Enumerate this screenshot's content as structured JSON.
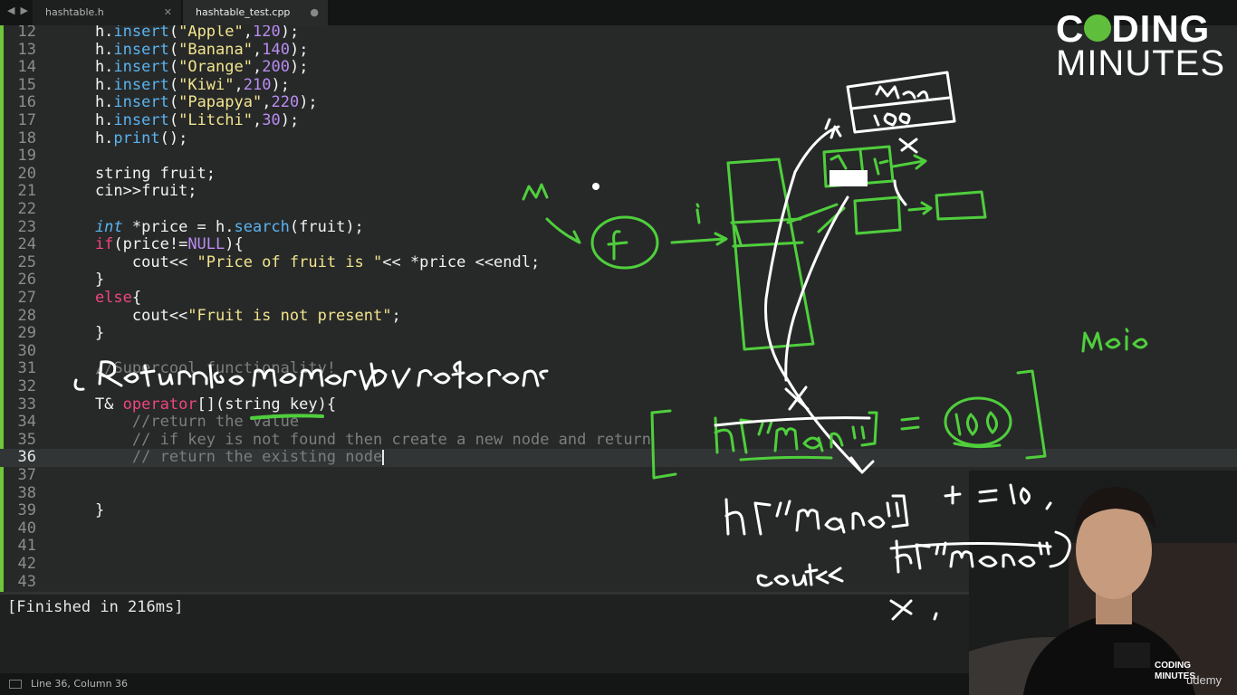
{
  "tabs": [
    {
      "label": "hashtable.h",
      "icon": "close-icon"
    },
    {
      "label": "hashtable_test.cpp",
      "icon": "dirty-dot-icon"
    }
  ],
  "editor": {
    "current_line": 36,
    "lines": [
      {
        "n": "12",
        "tokens": [
          [
            "plain",
            "    h."
          ],
          [
            "method",
            "insert"
          ],
          [
            "plain",
            "("
          ],
          [
            "string",
            "\"Apple\""
          ],
          [
            "plain",
            ","
          ],
          [
            "number",
            "120"
          ],
          [
            "plain",
            ");"
          ]
        ]
      },
      {
        "n": "13",
        "tokens": [
          [
            "plain",
            "    h."
          ],
          [
            "method",
            "insert"
          ],
          [
            "plain",
            "("
          ],
          [
            "string",
            "\"Banana\""
          ],
          [
            "plain",
            ","
          ],
          [
            "number",
            "140"
          ],
          [
            "plain",
            ");"
          ]
        ]
      },
      {
        "n": "14",
        "tokens": [
          [
            "plain",
            "    h."
          ],
          [
            "method",
            "insert"
          ],
          [
            "plain",
            "("
          ],
          [
            "string",
            "\"Orange\""
          ],
          [
            "plain",
            ","
          ],
          [
            "number",
            "200"
          ],
          [
            "plain",
            ");"
          ]
        ]
      },
      {
        "n": "15",
        "tokens": [
          [
            "plain",
            "    h."
          ],
          [
            "method",
            "insert"
          ],
          [
            "plain",
            "("
          ],
          [
            "string",
            "\"Kiwi\""
          ],
          [
            "plain",
            ","
          ],
          [
            "number",
            "210"
          ],
          [
            "plain",
            ");"
          ]
        ]
      },
      {
        "n": "16",
        "tokens": [
          [
            "plain",
            "    h."
          ],
          [
            "method",
            "insert"
          ],
          [
            "plain",
            "("
          ],
          [
            "string",
            "\"Papapya\""
          ],
          [
            "plain",
            ","
          ],
          [
            "number",
            "220"
          ],
          [
            "plain",
            ");"
          ]
        ]
      },
      {
        "n": "17",
        "tokens": [
          [
            "plain",
            "    h."
          ],
          [
            "method",
            "insert"
          ],
          [
            "plain",
            "("
          ],
          [
            "string",
            "\"Litchi\""
          ],
          [
            "plain",
            ","
          ],
          [
            "number",
            "30"
          ],
          [
            "plain",
            ");"
          ]
        ]
      },
      {
        "n": "18",
        "tokens": [
          [
            "plain",
            "    h."
          ],
          [
            "method",
            "print"
          ],
          [
            "plain",
            "();"
          ]
        ]
      },
      {
        "n": "19",
        "tokens": []
      },
      {
        "n": "20",
        "tokens": [
          [
            "plain",
            "    string fruit;"
          ]
        ]
      },
      {
        "n": "21",
        "tokens": [
          [
            "plain",
            "    cin>>fruit;"
          ]
        ]
      },
      {
        "n": "22",
        "tokens": []
      },
      {
        "n": "23",
        "tokens": [
          [
            "type",
            "    int"
          ],
          [
            "plain",
            " *price = h."
          ],
          [
            "method",
            "search"
          ],
          [
            "plain",
            "(fruit);"
          ]
        ]
      },
      {
        "n": "24",
        "tokens": [
          [
            "keyword",
            "    if"
          ],
          [
            "plain",
            "(price!="
          ],
          [
            "const",
            "NULL"
          ],
          [
            "plain",
            "){"
          ]
        ]
      },
      {
        "n": "25",
        "tokens": [
          [
            "plain",
            "        cout<< "
          ],
          [
            "string",
            "\"Price of fruit is \""
          ],
          [
            "plain",
            "<< *price <<endl;"
          ]
        ]
      },
      {
        "n": "26",
        "tokens": [
          [
            "plain",
            "    }"
          ]
        ]
      },
      {
        "n": "27",
        "tokens": [
          [
            "keyword",
            "    else"
          ],
          [
            "plain",
            "{"
          ]
        ]
      },
      {
        "n": "28",
        "tokens": [
          [
            "plain",
            "        cout<<"
          ],
          [
            "string",
            "\"Fruit is not present\""
          ],
          [
            "plain",
            ";"
          ]
        ]
      },
      {
        "n": "29",
        "tokens": [
          [
            "plain",
            "    }"
          ]
        ]
      },
      {
        "n": "30",
        "tokens": []
      },
      {
        "n": "31",
        "tokens": [
          [
            "comment",
            "    //Supercool functionality!"
          ]
        ]
      },
      {
        "n": "32",
        "tokens": []
      },
      {
        "n": "33",
        "tokens": [
          [
            "plain",
            "    T& "
          ],
          [
            "keyword",
            "operator"
          ],
          [
            "plain",
            "[](string key){"
          ]
        ]
      },
      {
        "n": "34",
        "tokens": [
          [
            "comment",
            "        //return the value"
          ]
        ]
      },
      {
        "n": "35",
        "tokens": [
          [
            "comment",
            "        // if key is not found then create a new node and return"
          ]
        ]
      },
      {
        "n": "36",
        "tokens": [
          [
            "comment",
            "        // return the existing node"
          ]
        ]
      },
      {
        "n": "37",
        "tokens": []
      },
      {
        "n": "38",
        "tokens": []
      },
      {
        "n": "39",
        "tokens": [
          [
            "plain",
            "    }"
          ]
        ]
      },
      {
        "n": "40",
        "tokens": []
      },
      {
        "n": "41",
        "tokens": []
      },
      {
        "n": "42",
        "tokens": []
      },
      {
        "n": "43",
        "tokens": []
      }
    ]
  },
  "console": {
    "output": "[Finished in 216ms]"
  },
  "statusbar": {
    "position": "Line 36, Column 36"
  },
  "logo": {
    "line1_a": "C",
    "line1_b": "DING",
    "line2": "MINUTES"
  },
  "watermark": {
    "text": "udemy"
  },
  "colors": {
    "gutter_accent": "#6ec63a",
    "annotation_green": "#4fcf3c",
    "annotation_white": "#ffffff"
  }
}
